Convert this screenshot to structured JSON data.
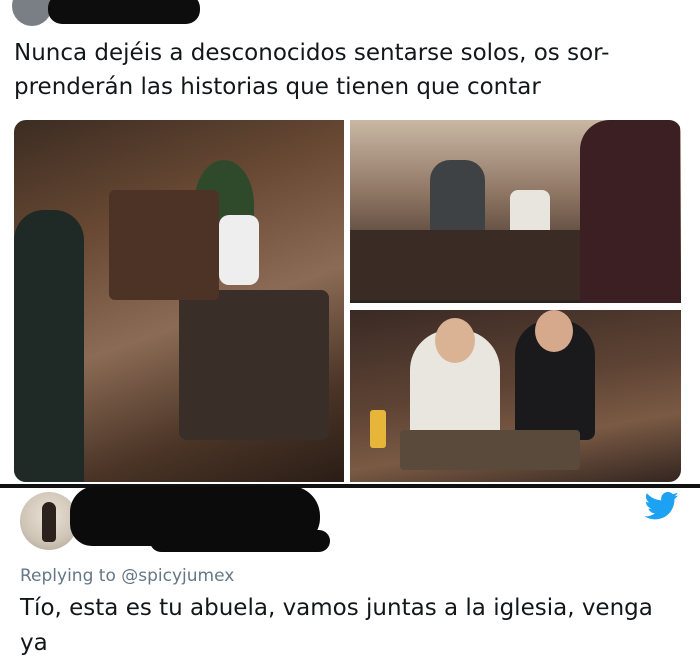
{
  "top_tweet": {
    "text": "Nunca dejéis a desconocidos sentarse solos, os sor-prenderán las historias que tienen que contar"
  },
  "reply": {
    "replying_to": "Replying to @spicyjumex",
    "text": "Tío, esta es tu abuela, vamos juntas a la iglesia, venga ya"
  },
  "icons": {
    "brand": "twitter-bird-icon"
  },
  "colors": {
    "twitter_blue": "#1da1f2",
    "muted_text": "#657786",
    "main_text": "#14171a"
  }
}
